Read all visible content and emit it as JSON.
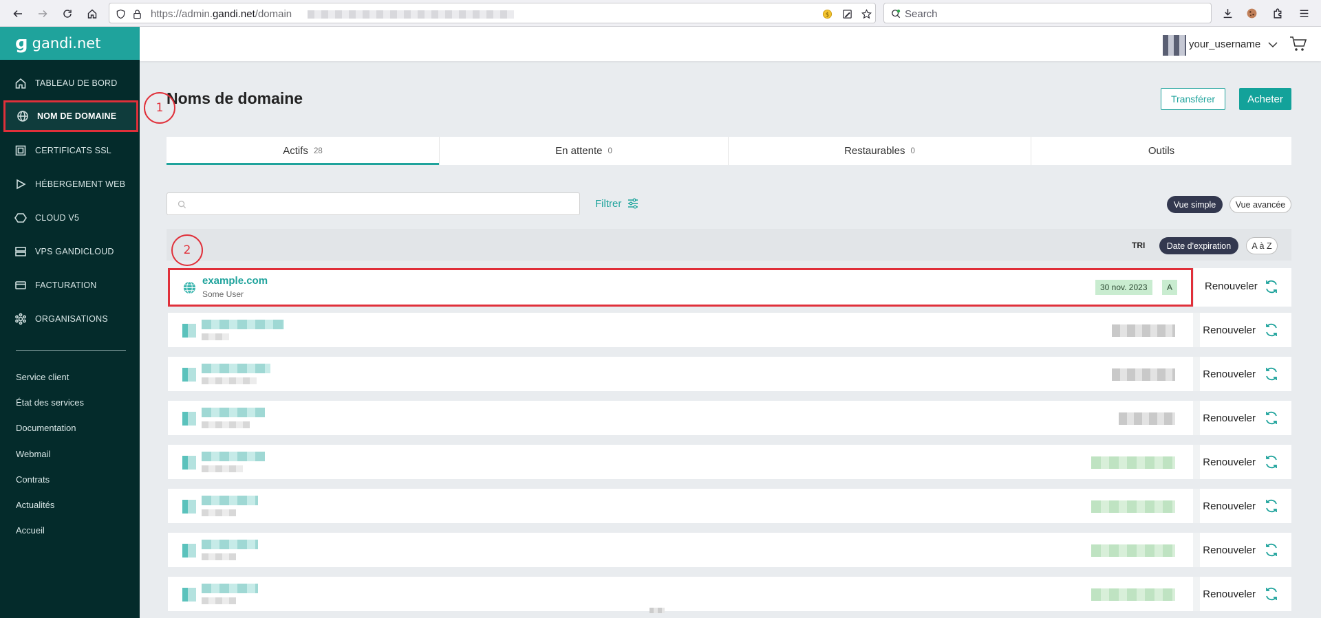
{
  "browser": {
    "url_prefix": "https://admin.",
    "url_domain": "gandi.net",
    "url_path": "/domain",
    "search_placeholder": "Search"
  },
  "sidebar": {
    "brand": "gandi.net",
    "items": [
      {
        "label": "TABLEAU DE BORD",
        "icon": "home-icon"
      },
      {
        "label": "NOM DE DOMAINE",
        "icon": "globe-icon"
      },
      {
        "label": "CERTIFICATS SSL",
        "icon": "certificate-icon"
      },
      {
        "label": "HÉBERGEMENT WEB",
        "icon": "play-icon"
      },
      {
        "label": "CLOUD V5",
        "icon": "cloud-icon"
      },
      {
        "label": "VPS GANDICLOUD",
        "icon": "server-icon"
      },
      {
        "label": "FACTURATION",
        "icon": "card-icon"
      },
      {
        "label": "ORGANISATIONS",
        "icon": "organisation-icon"
      }
    ],
    "links": [
      "Service client",
      "État des services",
      "Documentation",
      "Webmail",
      "Contrats",
      "Actualités",
      "Accueil"
    ]
  },
  "header": {
    "username": "your_username"
  },
  "page": {
    "title": "Noms de domaine",
    "transfer_label": "Transférer",
    "buy_label": "Acheter",
    "tabs": [
      {
        "label": "Actifs",
        "count": "28"
      },
      {
        "label": "En attente",
        "count": "0"
      },
      {
        "label": "Restaurables",
        "count": "0"
      },
      {
        "label": "Outils",
        "count": ""
      }
    ],
    "filter_label": "Filtrer",
    "view_simple": "Vue simple",
    "view_advanced": "Vue avancée",
    "sort_label": "TRI",
    "sort_expiration": "Date d'expiration",
    "sort_az": "A à Z",
    "renew_label": "Renouveler"
  },
  "domains": [
    {
      "name": "example.com",
      "owner": "Some User",
      "expiry": "30 nov. 2023",
      "badge": "A"
    }
  ],
  "annotations": [
    "1",
    "2"
  ],
  "colors": {
    "accent": "#1fa39c",
    "sidebar_bg": "#042b2b",
    "highlight": "#e0303a"
  }
}
